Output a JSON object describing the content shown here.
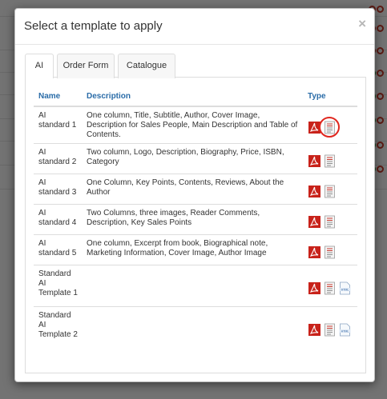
{
  "modal": {
    "title": "Select a template to apply",
    "close_label": "×"
  },
  "tabs": [
    {
      "label": "AI"
    },
    {
      "label": "Order Form"
    },
    {
      "label": "Catalogue"
    }
  ],
  "table": {
    "headers": {
      "name": "Name",
      "description": "Description",
      "type": "Type"
    },
    "rows": [
      {
        "name": "AI standard 1",
        "description": "One column, Title, Subtitle, Author, Cover Image, Description for Sales People, Main Description and Table of Contents.",
        "types": [
          "pdf-icon",
          "template-icon"
        ],
        "highlighted": "template-icon"
      },
      {
        "name": "AI standard 2",
        "description": "Two column, Logo, Description, Biography, Price, ISBN, Category",
        "types": [
          "pdf-icon",
          "template-icon"
        ]
      },
      {
        "name": "AI standard 3",
        "description": "One Column, Key Points, Contents, Reviews, About the Author",
        "types": [
          "pdf-icon",
          "template-icon"
        ]
      },
      {
        "name": "AI standard 4",
        "description": "Two Columns, three images, Reader Comments, Description, Key Sales Points",
        "types": [
          "pdf-icon",
          "template-icon"
        ]
      },
      {
        "name": "AI standard 5",
        "description": "One column, Excerpt from book, Biographical note, Marketing Information, Cover Image, Author Image",
        "types": [
          "pdf-icon",
          "template-icon"
        ]
      },
      {
        "name": "Standard AI Template 1",
        "description": "",
        "types": [
          "pdf-icon",
          "template-icon",
          "html-icon"
        ]
      },
      {
        "name": "Standard AI Template 2",
        "description": "",
        "types": [
          "pdf-icon",
          "template-icon",
          "html-icon"
        ]
      }
    ]
  },
  "icons": {
    "html_label": "HTML"
  },
  "colors": {
    "header_link": "#2a6ca8",
    "pdf_red": "#c8221a",
    "highlight_ring": "#e0261e",
    "status_green": "#2e9d3c",
    "status_red": "#cc3b2a"
  }
}
